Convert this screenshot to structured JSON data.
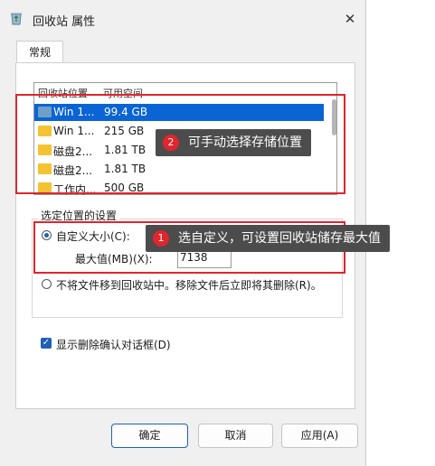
{
  "window": {
    "title": "回收站 属性",
    "close_glyph": "✕"
  },
  "tabs": [
    {
      "label": "常规"
    }
  ],
  "list": {
    "headers": {
      "location": "回收站位置",
      "capacity": "可用空间"
    },
    "rows": [
      {
        "name": "Win 1...",
        "size": "99.4 GB"
      },
      {
        "name": "Win 1...",
        "size": "215 GB"
      },
      {
        "name": "磁盘2...",
        "size": "1.81 TB"
      },
      {
        "name": "磁盘2...",
        "size": "1.81 TB"
      },
      {
        "name": "工作内...",
        "size": "500 GB"
      }
    ]
  },
  "settings": {
    "group_label": "选定位置的设置",
    "custom_size_label": "自定义大小(C):",
    "max_value_label": "最大值(MB)(X):",
    "max_value": "7138",
    "no_recycle_label": "不将文件移到回收站中。移除文件后立即将其删除(R)。",
    "confirm_label": "显示删除确认对话框(D)",
    "check_glyph": "✓"
  },
  "buttons": {
    "ok": "确定",
    "cancel": "取消",
    "apply": "应用(A)"
  },
  "annotations": {
    "tip1_num": "1",
    "tip1_text": "选自定义，可设置回收站储存最大值",
    "tip2_num": "2",
    "tip2_text": "可手动选择存储位置",
    "highlight_color": "#e0252c",
    "tip_bg": "#4c4c4c"
  },
  "colors": {
    "accent": "#1f5fb8",
    "selection": "#0a64d3"
  }
}
